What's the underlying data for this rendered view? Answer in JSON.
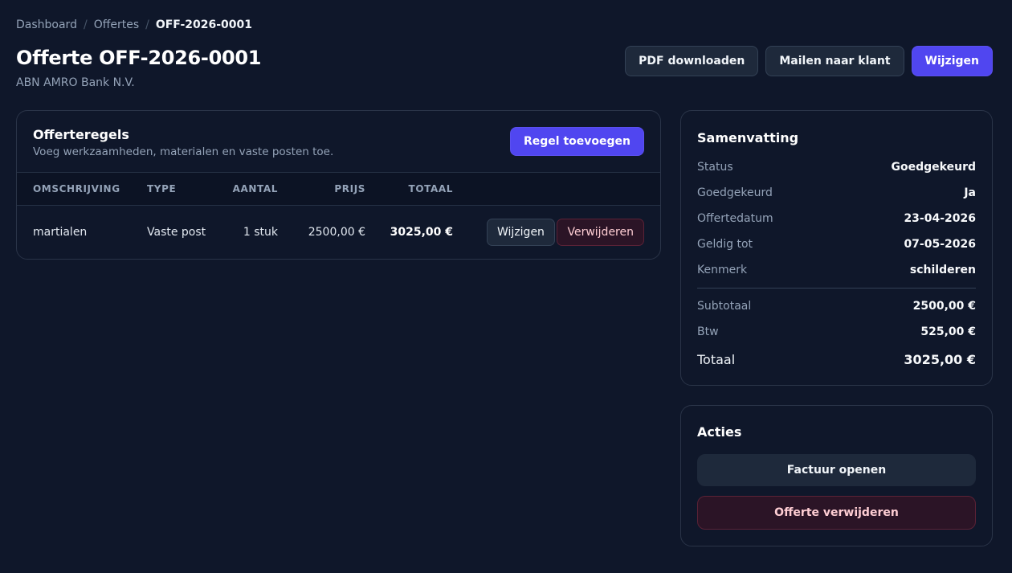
{
  "breadcrumb": {
    "items": [
      "Dashboard",
      "Offertes"
    ],
    "current": "OFF-2026-0001",
    "separator": "/"
  },
  "page": {
    "title": "Offerte OFF-2026-0001",
    "subtitle": "ABN AMRO Bank N.V."
  },
  "header_actions": {
    "pdf": "PDF downloaden",
    "mail": "Mailen naar klant",
    "edit": "Wijzigen"
  },
  "lines": {
    "title": "Offerteregels",
    "subtitle": "Voeg werkzaamheden, materialen en vaste posten toe.",
    "add_button": "Regel toevoegen",
    "columns": [
      "OMSCHRIJVING",
      "TYPE",
      "AANTAL",
      "PRIJS",
      "TOTAAL"
    ],
    "rows": [
      {
        "description": "martialen",
        "type": "Vaste post",
        "quantity": "1 stuk",
        "price": "2500,00 €",
        "total": "3025,00 €",
        "edit_label": "Wijzigen",
        "delete_label": "Verwijderen"
      }
    ]
  },
  "summary": {
    "title": "Samenvatting",
    "items": [
      {
        "label": "Status",
        "value": "Goedgekeurd"
      },
      {
        "label": "Goedgekeurd",
        "value": "Ja"
      },
      {
        "label": "Offertedatum",
        "value": "23-04-2026"
      },
      {
        "label": "Geldig tot",
        "value": "07-05-2026"
      },
      {
        "label": "Kenmerk",
        "value": "schilderen"
      }
    ],
    "totals": [
      {
        "label": "Subtotaal",
        "value": "2500,00 €"
      },
      {
        "label": "Btw",
        "value": "525,00 €"
      }
    ],
    "grand_total": {
      "label": "Totaal",
      "value": "3025,00 €"
    }
  },
  "actions": {
    "title": "Acties",
    "open_invoice": "Factuur openen",
    "delete_quote": "Offerte verwijderen"
  },
  "colors": {
    "background": "#0f172a",
    "primary": "#5046f0",
    "danger_bg": "#2b1426"
  }
}
